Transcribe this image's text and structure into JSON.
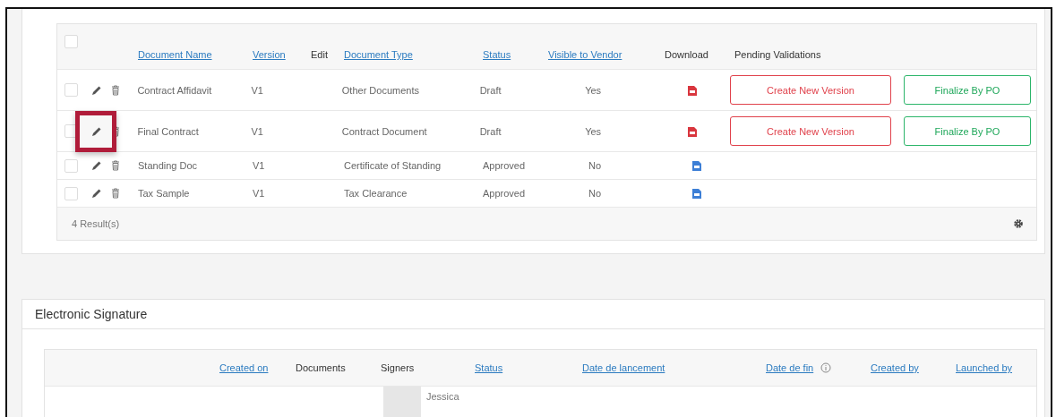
{
  "documents": {
    "all_checked": false,
    "columns": [
      {
        "label": "Document Name",
        "link": true
      },
      {
        "label": "Version",
        "link": true
      },
      {
        "label": "Edit",
        "link": false
      },
      {
        "label": "Document Type",
        "link": true
      },
      {
        "label": "Status",
        "link": true
      },
      {
        "label": "Visible to Vendor",
        "link": true
      },
      {
        "label": "Download",
        "link": false
      },
      {
        "label": "Pending Validations",
        "link": false
      }
    ],
    "rows": [
      {
        "checked": false,
        "name": "Contract Affidavit",
        "version": "V1",
        "type": "Other Documents",
        "status": "Draft",
        "visible": "Yes",
        "download": {
          "color": "#d9363e"
        },
        "highlighted": false,
        "actions": [
          {
            "label": "Create New Version",
            "kind": "danger"
          },
          {
            "label": "Finalize By PO",
            "kind": "success"
          }
        ]
      },
      {
        "checked": false,
        "name": "Final Contract",
        "version": "V1",
        "type": "Contract Document",
        "status": "Draft",
        "visible": "Yes",
        "download": {
          "color": "#d9363e"
        },
        "highlighted": true,
        "actions": [
          {
            "label": "Create New Version",
            "kind": "danger"
          },
          {
            "label": "Finalize By PO",
            "kind": "success"
          }
        ]
      },
      {
        "checked": false,
        "name": "Standing Doc",
        "version": "V1",
        "type": "Certificate of Standing",
        "status": "Approved",
        "visible": "No",
        "download": {
          "color": "#3d7fd6"
        },
        "highlighted": false
      },
      {
        "checked": false,
        "name": "Tax Sample",
        "version": "V1",
        "type": "Tax Clearance",
        "status": "Approved",
        "visible": "No",
        "download": {
          "color": "#3d7fd6"
        },
        "highlighted": false
      }
    ],
    "results": "4 Result(s)"
  },
  "signature": {
    "title": "Electronic Signature",
    "columns": [
      {
        "label": "Created on",
        "link": true
      },
      {
        "label": "Documents",
        "link": false
      },
      {
        "label": "Signers",
        "link": false
      },
      {
        "label": "Status",
        "link": true
      },
      {
        "label": "Date de lancement",
        "link": true
      },
      {
        "label": "Date de fin",
        "link": true,
        "info": true
      },
      {
        "label": "Created by",
        "link": true
      },
      {
        "label": "Launched by",
        "link": true
      }
    ],
    "rows": [
      {
        "signer": "Jessica"
      }
    ]
  }
}
